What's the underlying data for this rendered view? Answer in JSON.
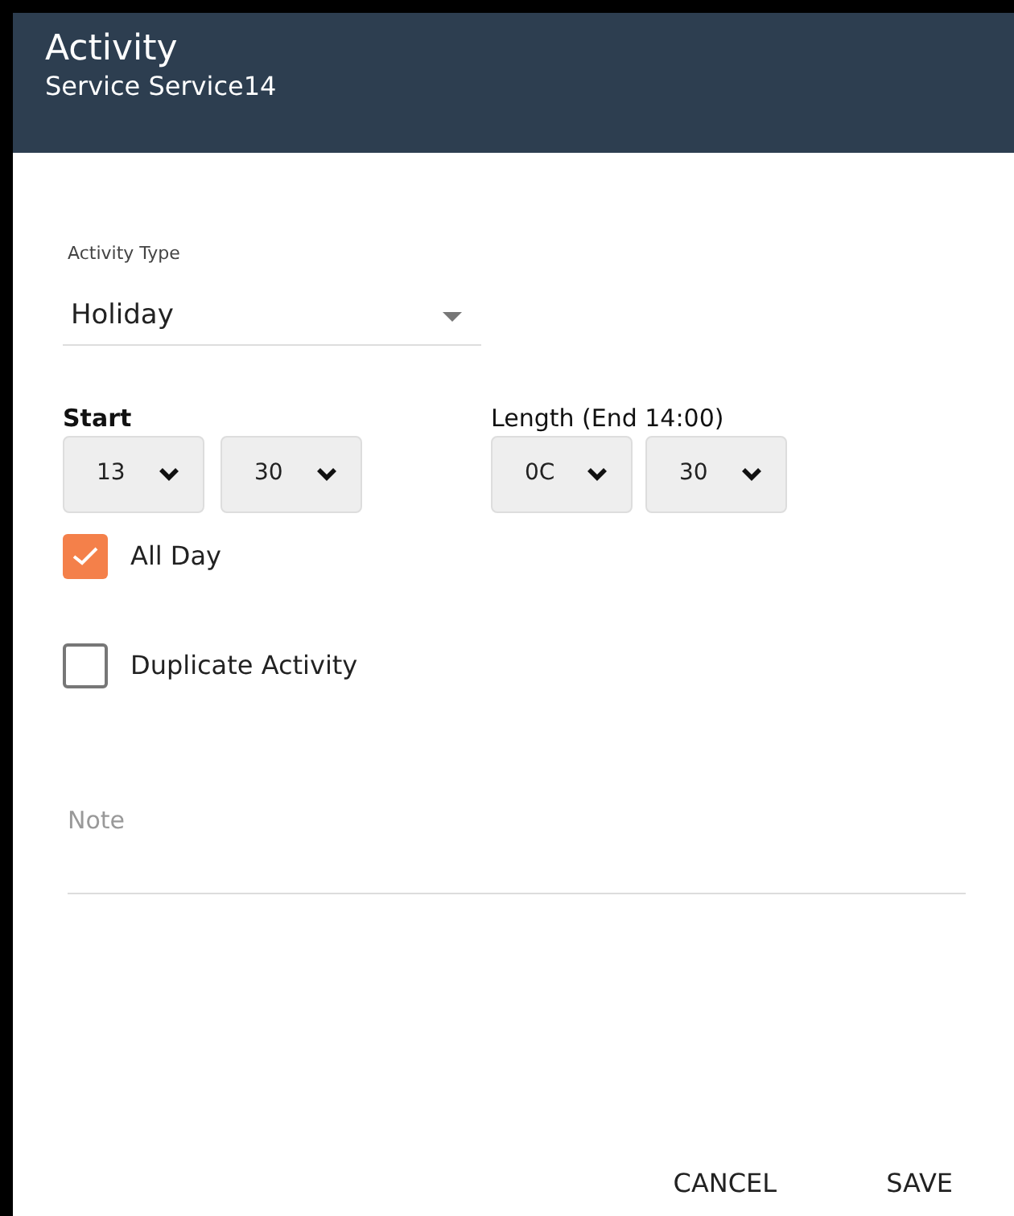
{
  "header": {
    "title": "Activity",
    "subtitle": "Service Service14"
  },
  "activity_type": {
    "label": "Activity Type",
    "value": "Holiday"
  },
  "start": {
    "label": "Start",
    "hour": "13",
    "minute": "30"
  },
  "length": {
    "label": "Length (End 14:00)",
    "hour": "0C",
    "minute": "30"
  },
  "checkboxes": [
    {
      "label": "All Day",
      "checked": true
    },
    {
      "label": "Duplicate Activity",
      "checked": false
    }
  ],
  "note": {
    "placeholder": "Note"
  },
  "buttons": [
    "CANCEL",
    "SAVE"
  ]
}
